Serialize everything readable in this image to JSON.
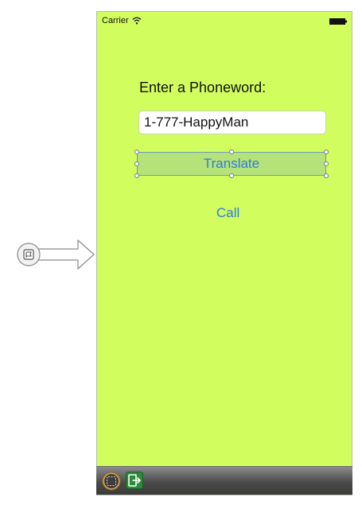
{
  "status_bar": {
    "carrier": "Carrier",
    "wifi_icon": "wifi-icon",
    "battery_icon": "battery-icon"
  },
  "scene": {
    "background_color": "#d1fd5f",
    "phone_label": "Enter a Phoneword:",
    "phone_input": {
      "value": "1-777-HappyMan",
      "placeholder": ""
    },
    "translate_button": "Translate",
    "call_button": "Call",
    "selected_element": "translate_button"
  },
  "entry_point": {
    "icon": "storyboard-entry-point-icon"
  },
  "dock": {
    "items": [
      {
        "icon": "view-controller-icon"
      },
      {
        "icon": "exit-icon"
      }
    ]
  },
  "colors": {
    "accent_blue": "#2f7bdf",
    "selection_fill": "#b6e27a",
    "dock_dark": "#3b3b3b"
  }
}
